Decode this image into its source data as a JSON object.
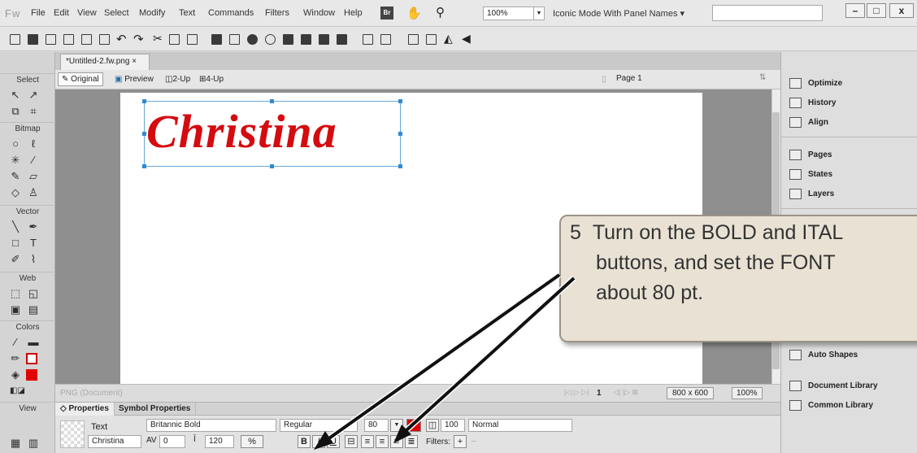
{
  "app": {
    "logo": "Fw",
    "menu": [
      "File",
      "Edit",
      "View",
      "Select",
      "Modify",
      "Text",
      "Commands",
      "Filters",
      "Window",
      "Help"
    ],
    "bridge_label": "Br",
    "zoom": "100%",
    "workspace": "Iconic Mode With Panel Names",
    "workspace_arrow": "▾",
    "win_min": "–",
    "win_max": "□",
    "win_close": "x"
  },
  "document": {
    "tab": "*Untitled-2.fw.png",
    "tab_close": "×",
    "views": [
      "Original",
      "Preview",
      "2-Up",
      "4-Up"
    ],
    "page": "Page 1",
    "canvas_text": "Christina",
    "status_left": "PNG (Document)",
    "page_num": "1",
    "size": "800 x 600",
    "zoom": "100%"
  },
  "tools": {
    "sections": [
      "Select",
      "Bitmap",
      "Vector",
      "Web",
      "Colors",
      "View"
    ]
  },
  "properties": {
    "tabs": [
      "◇ Properties",
      "Symbol Properties"
    ],
    "type_label": "Text",
    "object_name": "Christina",
    "font": "Britannic Bold",
    "style": "Regular",
    "size": "80",
    "kerning": "0",
    "leading": "120",
    "leading_unit": "%",
    "opacity": "100",
    "blend": "Normal",
    "bold": "B",
    "italic": "I",
    "underline": "U",
    "filters_label": "Filters:",
    "filters_add": "+",
    "filters_remove": "–",
    "text_color": "#e00000"
  },
  "panels": {
    "top": [
      "Optimize",
      "History",
      "Align"
    ],
    "mid": [
      "Pages",
      "States",
      "Layers"
    ],
    "bottom": [
      "Auto Shapes",
      "Document Library",
      "Common Library"
    ]
  },
  "callout": {
    "number": "5",
    "line1": "Turn on the BOLD and ITAL",
    "line2": "buttons, and set the FONT",
    "line3": "about 80 pt."
  }
}
